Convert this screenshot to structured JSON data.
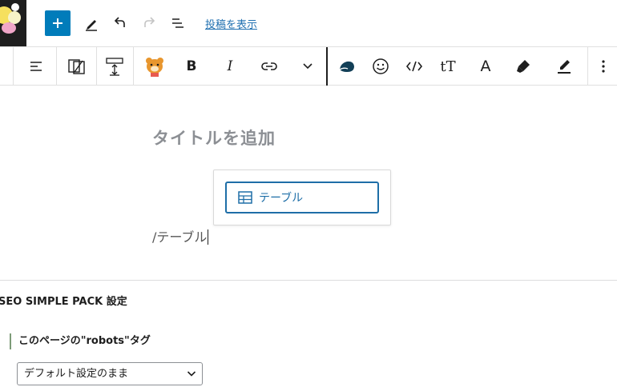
{
  "topbar": {
    "add_block_icon": "plus-icon",
    "tools_icon": "pencil-icon",
    "undo_icon": "undo-icon",
    "redo_icon": "redo-icon",
    "outline_icon": "list-view-icon",
    "view_post_label": "投稿を表示",
    "accent_color": "#007cba"
  },
  "block_toolbar": {
    "items": [
      {
        "name": "align-icon"
      },
      {
        "name": "block-mover-icon"
      },
      {
        "name": "block-transform-icon"
      },
      {
        "name": "bear-icon"
      },
      {
        "name": "bold-text",
        "text": "B"
      },
      {
        "name": "italic-text",
        "text": "I"
      },
      {
        "name": "link-icon"
      },
      {
        "name": "chevron-down-icon"
      },
      {
        "name": "pebble-icon"
      },
      {
        "name": "emoji-icon"
      },
      {
        "name": "code-icon"
      },
      {
        "name": "font-size-text",
        "text": "tT"
      },
      {
        "name": "text-color-text",
        "text": "A"
      },
      {
        "name": "highlighter-icon"
      },
      {
        "name": "marker-icon"
      },
      {
        "name": "more-options-icon"
      }
    ]
  },
  "editor": {
    "title_placeholder": "タイトルを追加",
    "typed_text": "/テーブル",
    "autocomplete": {
      "items": [
        {
          "icon": "table-icon",
          "label": "テーブル"
        }
      ]
    }
  },
  "metabox": {
    "title": "SEO SIMPLE PACK 設定",
    "field_label": "このページの\"robots\"タグ",
    "select_value": "デフォルト設定のまま"
  }
}
